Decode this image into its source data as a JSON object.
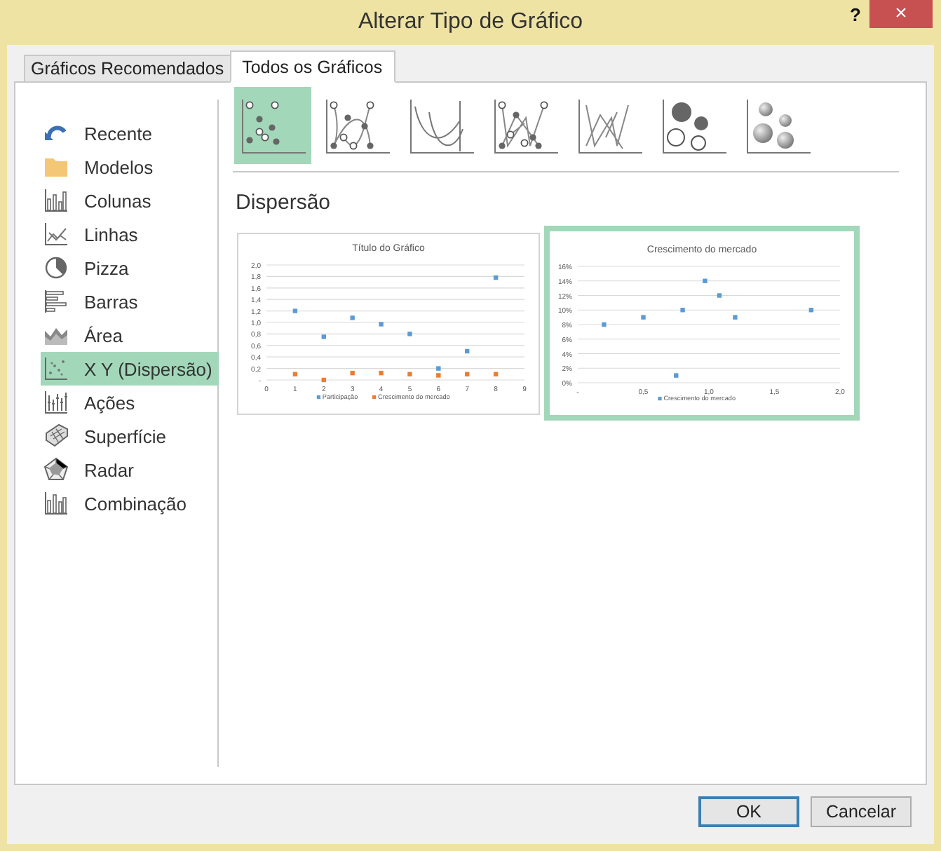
{
  "window": {
    "title": "Alterar Tipo de Gráfico",
    "help_button": "?",
    "close_button": "×"
  },
  "tabs": [
    {
      "label": "Gráficos Recomendados",
      "selected": false
    },
    {
      "label": "Todos os Gráficos",
      "selected": true
    }
  ],
  "sidebar": {
    "items": [
      {
        "kind": "recent",
        "label": "Recente",
        "selected": false
      },
      {
        "kind": "folder",
        "label": "Modelos",
        "selected": false
      },
      {
        "kind": "column",
        "label": "Colunas",
        "selected": false
      },
      {
        "kind": "line",
        "label": "Linhas",
        "selected": false
      },
      {
        "kind": "pie",
        "label": "Pizza",
        "selected": false
      },
      {
        "kind": "bar",
        "label": "Barras",
        "selected": false
      },
      {
        "kind": "area",
        "label": "Área",
        "selected": false
      },
      {
        "kind": "scatter",
        "label": "X Y (Dispersão)",
        "selected": true
      },
      {
        "kind": "stock",
        "label": "Ações",
        "selected": false
      },
      {
        "kind": "surface",
        "label": "Superfície",
        "selected": false
      },
      {
        "kind": "radar",
        "label": "Radar",
        "selected": false
      },
      {
        "kind": "combo",
        "label": "Combinação",
        "selected": false
      }
    ]
  },
  "chart_types": [
    {
      "kind": "scatter",
      "selected": true
    },
    {
      "kind": "smooth-markers",
      "selected": false
    },
    {
      "kind": "smooth",
      "selected": false
    },
    {
      "kind": "straight-markers",
      "selected": false
    },
    {
      "kind": "straight",
      "selected": false
    },
    {
      "kind": "bubble",
      "selected": false
    },
    {
      "kind": "bubble-3d",
      "selected": false
    }
  ],
  "section_title": "Dispersão",
  "previews": [
    {
      "selected": false,
      "chart_data": {
        "type": "scatter",
        "title": "Título do Gráfico",
        "grid": true,
        "legend": true,
        "x": [
          1,
          2,
          3,
          4,
          5,
          6,
          7,
          8
        ],
        "series": [
          {
            "name": "Participação",
            "color": "#5b9bd5",
            "values": [
              1.2,
              0.75,
              1.08,
              0.97,
              0.8,
              0.2,
              0.5,
              1.78
            ]
          },
          {
            "name": "Crescimento do mercado",
            "color": "#ed7d31",
            "values": [
              0.1,
              0,
              0.12,
              0.12,
              0.1,
              0.08,
              0.1,
              0.1
            ]
          }
        ],
        "xlim": [
          0,
          9
        ],
        "ylim": [
          0,
          2
        ],
        "xticks": [
          0,
          1,
          2,
          3,
          4,
          5,
          6,
          7,
          8,
          9
        ],
        "yticks": [
          {
            "value": 0,
            "label": "-"
          },
          {
            "value": 0.2,
            "label": "0,2"
          },
          {
            "value": 0.4,
            "label": "0,4"
          },
          {
            "value": 0.6,
            "label": "0,6"
          },
          {
            "value": 0.8,
            "label": "0,8"
          },
          {
            "value": 1,
            "label": "1,0"
          },
          {
            "value": 1.2,
            "label": "1,2"
          },
          {
            "value": 1.4,
            "label": "1,4"
          },
          {
            "value": 1.6,
            "label": "1,6"
          },
          {
            "value": 1.8,
            "label": "1,8"
          },
          {
            "value": 2,
            "label": "2,0"
          }
        ]
      }
    },
    {
      "selected": true,
      "chart_data": {
        "type": "scatter",
        "title": "Crescimento do mercado",
        "grid": true,
        "legend": true,
        "x": [
          0.2,
          0.5,
          0.75,
          0.8,
          0.97,
          1.08,
          1.2,
          1.78
        ],
        "series": [
          {
            "name": "Crescimento do mercado",
            "color": "#5b9bd5",
            "values": [
              0.08,
              0.09,
              0.01,
              0.1,
              0.14,
              0.12,
              0.09,
              0.1
            ]
          }
        ],
        "xlim": [
          0,
          2
        ],
        "ylim": [
          0,
          0.16
        ],
        "xticks": [
          {
            "value": 0,
            "label": "-"
          },
          {
            "value": 0.5,
            "label": "0,5"
          },
          {
            "value": 1,
            "label": "1,0"
          },
          {
            "value": 1.5,
            "label": "1,5"
          },
          {
            "value": 2,
            "label": "2,0"
          }
        ],
        "yticks": [
          {
            "value": 0,
            "label": "0%"
          },
          {
            "value": 0.02,
            "label": "2%"
          },
          {
            "value": 0.04,
            "label": "4%"
          },
          {
            "value": 0.06,
            "label": "6%"
          },
          {
            "value": 0.08,
            "label": "8%"
          },
          {
            "value": 0.1,
            "label": "10%"
          },
          {
            "value": 0.12,
            "label": "12%"
          },
          {
            "value": 0.14,
            "label": "14%"
          },
          {
            "value": 0.16,
            "label": "16%"
          }
        ]
      }
    }
  ],
  "buttons": [
    {
      "label": "OK",
      "default": true
    },
    {
      "label": "Cancelar",
      "default": false
    }
  ]
}
